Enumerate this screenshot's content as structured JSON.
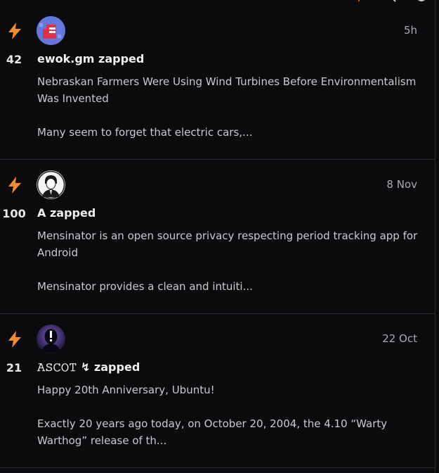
{
  "colors": {
    "accent": "#f28b2e",
    "background": "#0b0b0d",
    "divider": "#2a2a2e"
  },
  "topbar": {
    "icons": [
      "chevron-down-icon",
      "lightning-icon",
      "search-icon",
      "settings-icon"
    ]
  },
  "items": [
    {
      "count": "42",
      "avatar_icon": "nostr-avatar-red-icon",
      "time": "5h",
      "actor": "ewok.gm zapped",
      "title": "Nebraskan Farmers Were Using Wind Turbines Before Environmentalism Was Invented",
      "excerpt": "Many seem to forget that electric cars,..."
    },
    {
      "count": "100",
      "avatar_icon": "person-avatar-icon",
      "time": "8 Nov",
      "actor": "A zapped",
      "title": "Mensinator is an open source privacy respecting period tracking app for Android",
      "excerpt": "Mensinator provides a clean and intuiti..."
    },
    {
      "count": "21",
      "avatar_icon": "exclamation-avatar-icon",
      "time": "22 Oct",
      "actor": "𝙰𝚂𝙲𝙾𝚃 ↯ zapped",
      "title": "Happy 20th Anniversary, Ubuntu!",
      "excerpt": "Exactly 20 years ago today, on October 20, 2004, the 4.10 “Warty Warthog” release of th..."
    }
  ]
}
